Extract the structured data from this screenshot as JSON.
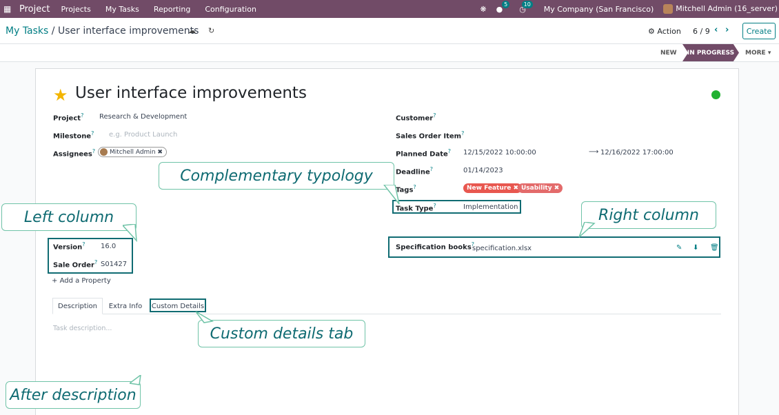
{
  "navbar": {
    "app_name": "Project",
    "menu": [
      "Projects",
      "My Tasks",
      "Reporting",
      "Configuration"
    ],
    "messages_count": "5",
    "activities_count": "10",
    "company": "My Company (San Francisco)",
    "user": "Mitchell Admin (16_server)"
  },
  "control": {
    "breadcrumb_parent": "My Tasks",
    "breadcrumb_sep": "/",
    "breadcrumb_current": "User interface improvements",
    "action_label": "Action",
    "pager": "6 / 9",
    "create_label": "Create"
  },
  "status": {
    "stages": [
      "NEW",
      "IN PROGRESS"
    ],
    "more_label": "MORE"
  },
  "task": {
    "title": "User interface improvements",
    "left": {
      "project_label": "Project",
      "project_value": "Research & Development",
      "milestone_label": "Milestone",
      "milestone_placeholder": "e.g. Product Launch",
      "assignees_label": "Assignees",
      "assignee": "Mitchell Admin",
      "version_label": "Version",
      "version_value": "16.0",
      "sale_order_label": "Sale Order",
      "sale_order_value": "S01427",
      "add_property": "Add a Property"
    },
    "right": {
      "customer_label": "Customer",
      "sales_order_item_label": "Sales Order Item",
      "planned_date_label": "Planned Date",
      "planned_start": "12/15/2022 10:00:00",
      "planned_end": "12/16/2022 17:00:00",
      "deadline_label": "Deadline",
      "deadline_value": "01/14/2023",
      "tags_label": "Tags",
      "tags": [
        "New Feature",
        "Usability"
      ],
      "task_type_label": "Task Type",
      "task_type_value": "Implementation",
      "spec_label": "Specification books",
      "spec_file": "specification.xlsx"
    },
    "tabs": [
      "Description",
      "Extra Info",
      "Custom Details"
    ],
    "description_placeholder": "Task description..."
  },
  "colors": {
    "brand": "#714b67",
    "accent": "#017e84",
    "tag_new_feature": "#e8574f",
    "tag_usability": "#e36b6b",
    "callout_text": "#0f6b72",
    "kanban_state": "#21b131"
  },
  "callouts": {
    "complementary": "Complementary typology",
    "left_column": "Left column",
    "right_column": "Right column",
    "custom_tab": "Custom details tab",
    "after_description": "After description"
  }
}
